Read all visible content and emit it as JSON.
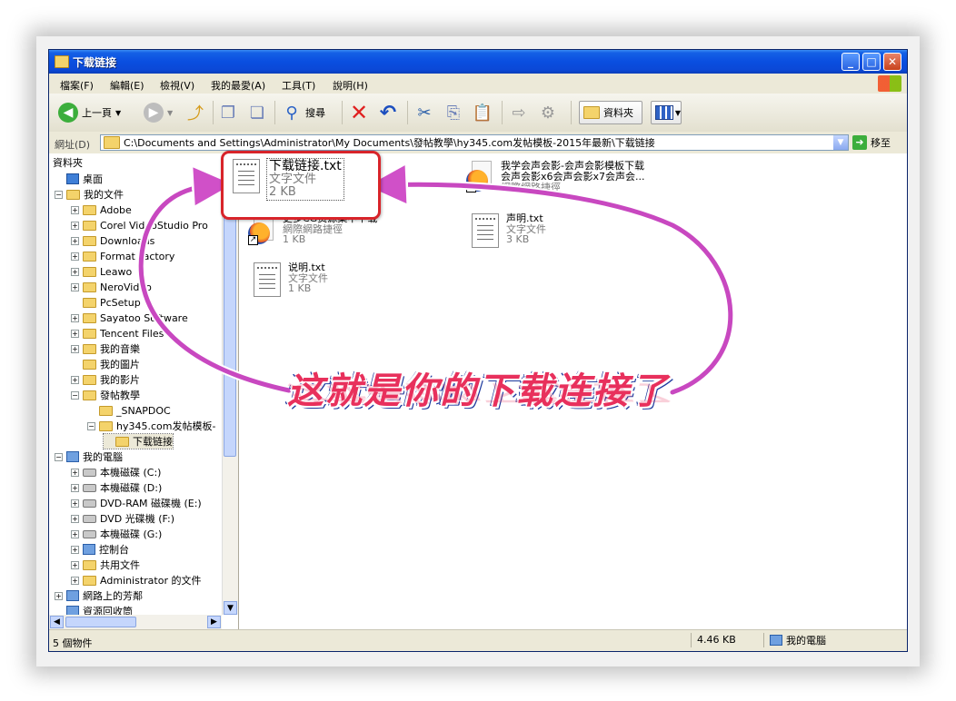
{
  "window": {
    "title": "下载链接",
    "controls": {
      "minimize": "_",
      "maximize": "□",
      "close": "✕"
    }
  },
  "menu": [
    "檔案(F)",
    "編輯(E)",
    "檢視(V)",
    "我的最愛(A)",
    "工具(T)",
    "說明(H)"
  ],
  "toolbar": {
    "back_label": "上一頁",
    "search_label": "搜尋",
    "folders_label": "資料夾"
  },
  "address": {
    "label": "網址(D)",
    "path": "C:\\Documents and Settings\\Administrator\\My Documents\\發帖教學\\hy345.com发帖模板-2015年最新\\下载链接",
    "go_label": "移至"
  },
  "tree": {
    "title": "資料夾",
    "items": [
      {
        "label": "桌面",
        "icon": "desktop-icon",
        "expander": ""
      },
      {
        "label": "我的文件",
        "icon": "folder-icon",
        "expander": "−"
      },
      {
        "label": "Adobe",
        "icon": "folder-icon",
        "expander": "+"
      },
      {
        "label": "Corel VideoStudio Pro",
        "icon": "folder-icon",
        "expander": "+"
      },
      {
        "label": "Downloads",
        "icon": "folder-icon",
        "expander": "+"
      },
      {
        "label": "Format Factory",
        "icon": "folder-icon",
        "expander": "+"
      },
      {
        "label": "Leawo",
        "icon": "folder-icon",
        "expander": "+"
      },
      {
        "label": "NeroVideo",
        "icon": "folder-icon",
        "expander": "+"
      },
      {
        "label": "PcSetup",
        "icon": "folder-icon",
        "expander": ""
      },
      {
        "label": "Sayatoo Software",
        "icon": "folder-icon",
        "expander": "+"
      },
      {
        "label": "Tencent Files",
        "icon": "folder-icon",
        "expander": "+"
      },
      {
        "label": "我的音樂",
        "icon": "music-folder-icon",
        "expander": "+"
      },
      {
        "label": "我的圖片",
        "icon": "picture-folder-icon",
        "expander": ""
      },
      {
        "label": "我的影片",
        "icon": "video-folder-icon",
        "expander": "+"
      },
      {
        "label": "發帖教學",
        "icon": "folder-icon",
        "expander": "−"
      },
      {
        "label": "_SNAPDOC",
        "icon": "folder-icon",
        "expander": ""
      },
      {
        "label": "hy345.com发帖模板-",
        "icon": "folder-icon",
        "expander": "−"
      },
      {
        "label": "下载链接",
        "icon": "folder-open-icon",
        "expander": ""
      },
      {
        "label": "我的電腦",
        "icon": "computer-icon",
        "expander": "−"
      },
      {
        "label": "本機磁碟 (C:)",
        "icon": "drive-icon",
        "expander": "+"
      },
      {
        "label": "本機磁碟 (D:)",
        "icon": "drive-icon",
        "expander": "+"
      },
      {
        "label": "DVD-RAM 磁碟機 (E:)",
        "icon": "dvd-icon",
        "expander": "+"
      },
      {
        "label": "DVD 光碟機 (F:)",
        "icon": "dvd-icon",
        "expander": "+"
      },
      {
        "label": "本機磁碟 (G:)",
        "icon": "drive-icon",
        "expander": "+"
      },
      {
        "label": "控制台",
        "icon": "control-panel-icon",
        "expander": "+"
      },
      {
        "label": "共用文件",
        "icon": "folder-icon",
        "expander": "+"
      },
      {
        "label": "Administrator 的文件",
        "icon": "folder-icon",
        "expander": "+"
      },
      {
        "label": "網路上的芳鄰",
        "icon": "network-icon",
        "expander": "+"
      },
      {
        "label": "資源回收筒",
        "icon": "recycle-bin-icon",
        "expander": ""
      }
    ]
  },
  "files": [
    {
      "name": "下载链接.txt",
      "type": "文字文件",
      "size": "2 KB",
      "kind": "txt"
    },
    {
      "name": "我学会声会影-会声会影模板下载",
      "name2": "会声会影x6会声会影x7会声会...",
      "type": "網際網路捷徑",
      "size": "",
      "kind": "url"
    },
    {
      "name": "更多CG资源集中下载",
      "type": "網際網路捷徑",
      "size": "1 KB",
      "kind": "url"
    },
    {
      "name": "声明.txt",
      "type": "文字文件",
      "size": "3 KB",
      "kind": "txt"
    },
    {
      "name": "说明.txt",
      "type": "文字文件",
      "size": "1 KB",
      "kind": "txt"
    }
  ],
  "status": {
    "count": "5 個物件",
    "size": "4.46 KB",
    "location": "我的電腦"
  },
  "annotation": {
    "text": "这就是你的下载连接了",
    "color": "#e8305c",
    "arrow_color": "#c040c0"
  }
}
